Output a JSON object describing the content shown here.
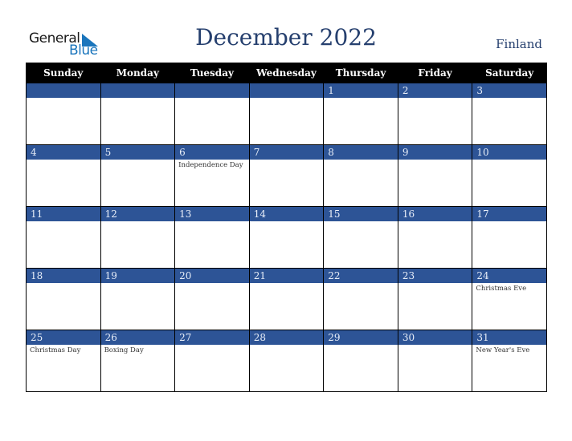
{
  "logo": {
    "word1": "General",
    "word2": "Blue"
  },
  "title": "December 2022",
  "country": "Finland",
  "colors": {
    "header_bg": "#000000",
    "date_band": "#2d5496",
    "title": "#253f6e",
    "logo_blue": "#1a75bc"
  },
  "weekdays": [
    "Sunday",
    "Monday",
    "Tuesday",
    "Wednesday",
    "Thursday",
    "Friday",
    "Saturday"
  ],
  "weeks": [
    [
      {
        "d": ""
      },
      {
        "d": ""
      },
      {
        "d": ""
      },
      {
        "d": ""
      },
      {
        "d": "1"
      },
      {
        "d": "2"
      },
      {
        "d": "3"
      }
    ],
    [
      {
        "d": "4"
      },
      {
        "d": "5"
      },
      {
        "d": "6",
        "e": "Independence Day"
      },
      {
        "d": "7"
      },
      {
        "d": "8"
      },
      {
        "d": "9"
      },
      {
        "d": "10"
      }
    ],
    [
      {
        "d": "11"
      },
      {
        "d": "12"
      },
      {
        "d": "13"
      },
      {
        "d": "14"
      },
      {
        "d": "15"
      },
      {
        "d": "16"
      },
      {
        "d": "17"
      }
    ],
    [
      {
        "d": "18"
      },
      {
        "d": "19"
      },
      {
        "d": "20"
      },
      {
        "d": "21"
      },
      {
        "d": "22"
      },
      {
        "d": "23"
      },
      {
        "d": "24",
        "e": "Christmas Eve"
      }
    ],
    [
      {
        "d": "25",
        "e": "Christmas Day"
      },
      {
        "d": "26",
        "e": "Boxing Day"
      },
      {
        "d": "27"
      },
      {
        "d": "28"
      },
      {
        "d": "29"
      },
      {
        "d": "30"
      },
      {
        "d": "31",
        "e": "New Year's Eve"
      }
    ]
  ]
}
